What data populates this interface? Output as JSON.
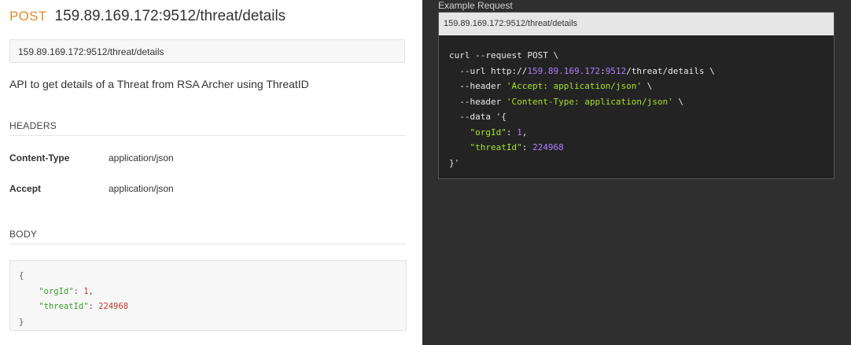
{
  "left": {
    "method": "POST",
    "endpoint": "159.89.169.172:9512/threat/details",
    "url": "159.89.169.172:9512/threat/details",
    "description": "API to get details of a Threat from RSA Archer using ThreatID",
    "headers_title": "HEADERS",
    "headers": [
      {
        "key": "Content-Type",
        "value": "application/json"
      },
      {
        "key": "Accept",
        "value": "application/json"
      }
    ],
    "body_title": "BODY",
    "body": {
      "open": "{",
      "key1": "\"orgId\"",
      "sep1": ": ",
      "val1": "1",
      "comma1": ",",
      "key2": "\"threatId\"",
      "sep2": ": ",
      "val2": "224968",
      "close": "}"
    }
  },
  "right": {
    "label": "Example Request",
    "url": "159.89.169.172:9512/threat/details",
    "code": {
      "l1": "curl --request POST \\",
      "l2_pre": "  --url http://",
      "l2_host": "159.89.169.172",
      "l2_colon": ":",
      "l2_port": "9512",
      "l2_post": "/threat/details \\",
      "l3_pre": "  --header ",
      "l3_str": "'Accept: application/json'",
      "l3_post": " \\",
      "l4_pre": "  --header ",
      "l4_str": "'Content-Type: application/json'",
      "l4_post": " \\",
      "l5": "  --data '{",
      "l6_pre": "    ",
      "l6_key": "\"orgId\"",
      "l6_sep": ": ",
      "l6_val": "1",
      "l6_comma": ",",
      "l7_pre": "    ",
      "l7_key": "\"threatId\"",
      "l7_sep": ": ",
      "l7_val": "224968",
      "l8": "}'"
    }
  }
}
